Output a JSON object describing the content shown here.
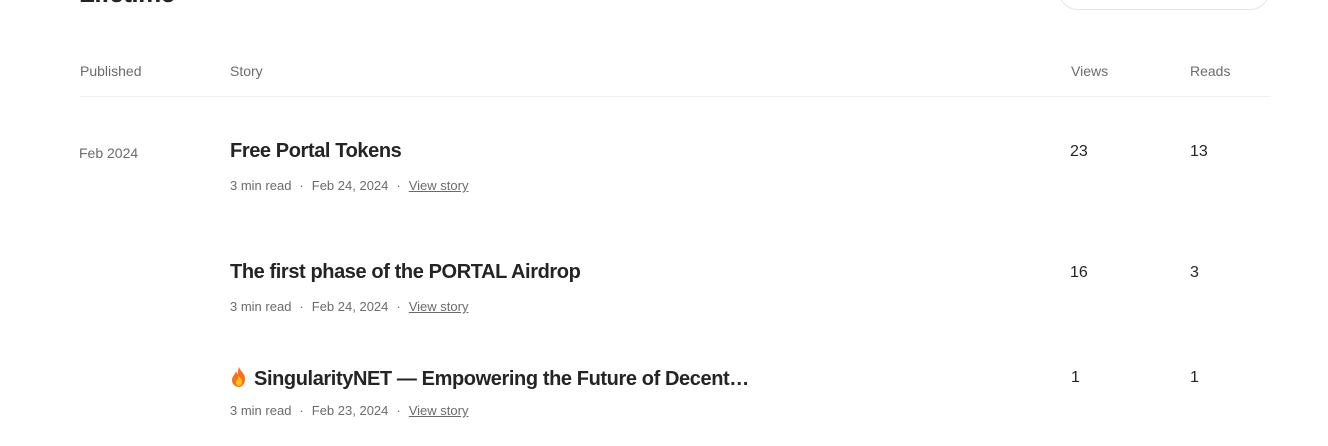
{
  "page": {
    "title": "Lifetime"
  },
  "table": {
    "headers": {
      "published": "Published",
      "story": "Story",
      "views": "Views",
      "reads": "Reads"
    },
    "rows": [
      {
        "published": "Feb 2024",
        "title": "Free Portal Tokens",
        "read_time": "3 min read",
        "date": "Feb 24, 2024",
        "link": "View story",
        "views": "23",
        "reads": "13"
      },
      {
        "published": "",
        "title": "The first phase of the PORTAL Airdrop",
        "read_time": "3 min read",
        "date": "Feb 24, 2024",
        "link": "View story",
        "views": "16",
        "reads": "3"
      },
      {
        "published": "",
        "icon": "fire-emoji-icon",
        "title": "SingularityNET — Empowering the Future of Decent…",
        "read_time": "3 min read",
        "date": "Feb 23, 2024",
        "link": "View story",
        "views": "1",
        "reads": "1"
      }
    ]
  },
  "meta_separator": "·"
}
